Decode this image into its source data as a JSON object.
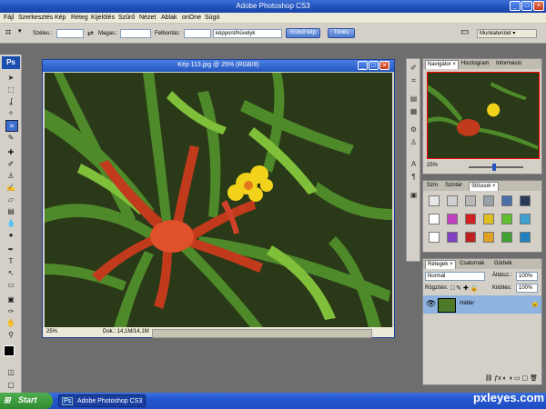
{
  "app": {
    "title": "Adobe Photoshop CS3",
    "logo": "Ps"
  },
  "menu": [
    "Fájl",
    "Szerkesztés",
    "Kép",
    "Réteg",
    "Kijelölés",
    "Szűrő",
    "Nézet",
    "Ablak",
    "onOne",
    "Súgó"
  ],
  "options": {
    "width_label": "Széles.:",
    "height_label": "Magas.:",
    "resolution_label": "Felbontás:",
    "unit": "képpont/hüvelyk",
    "front_image_button": "Elülső kép",
    "clear_button": "Törlés",
    "workspace": "Munkaterület ▾"
  },
  "document": {
    "title": "Kép 113.jpg @ 25% (RGB/8)",
    "zoom": "25%",
    "doc_info": "Dok.: 14,1M/14,1M"
  },
  "navigator": {
    "tabs": [
      "Navigátor ×",
      "Hisztogram",
      "Információ"
    ],
    "zoom": "25%"
  },
  "styles": {
    "tabs": [
      "Szín",
      "Szintár",
      "Stílusok ×"
    ],
    "swatches": [
      "#e8e8e8",
      "#d0d0d0",
      "#b8b8b8",
      "#9aa0a8",
      "#4a6fa8",
      "#2a3a58",
      "#ffffff",
      "#c040c0",
      "#d02020",
      "#e0c020",
      "#60c030",
      "#40a0d0",
      "#ffffff",
      "#8040c0",
      "#c02020",
      "#e0a020",
      "#40a030",
      "#2080c0"
    ]
  },
  "layers": {
    "tabs": [
      "Rétegek ×",
      "Csatornák",
      "Görbék"
    ],
    "blend_mode": "Normál",
    "opacity_label": "Átlátsz.:",
    "opacity": "100%",
    "lock_label": "Rögzítés:",
    "fill_label": "Kitöltés:",
    "fill": "100%",
    "layer_name": "Háttér"
  },
  "taskbar": {
    "start": "Start",
    "item": "Adobe Photoshop CS3"
  },
  "watermark": "pxleyes.com"
}
